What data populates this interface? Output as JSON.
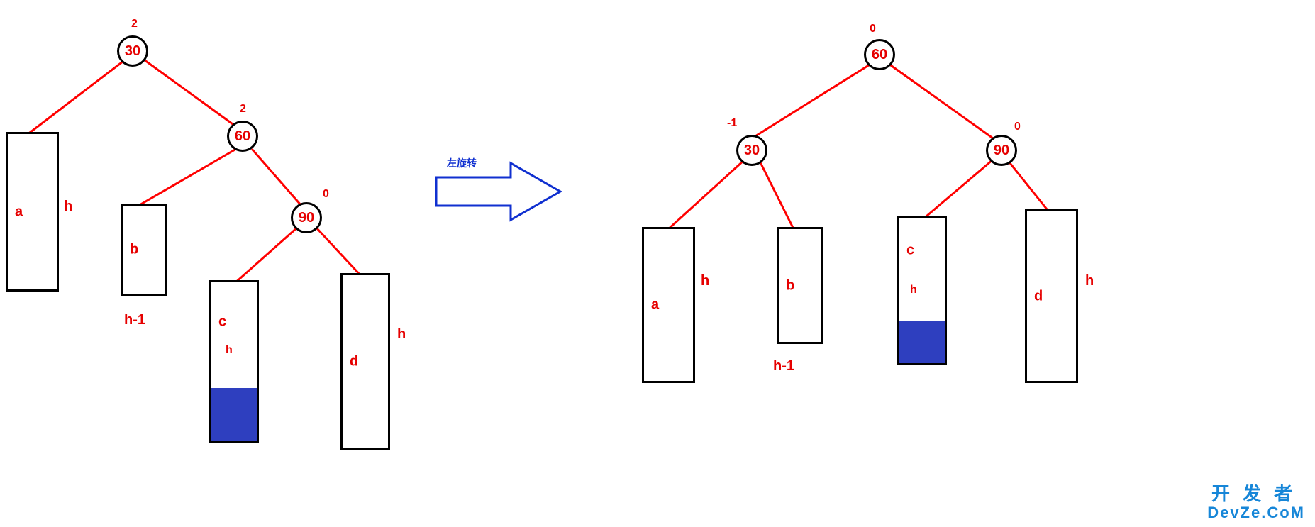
{
  "operation_label": "左旋转",
  "watermark": {
    "line1": "开发者",
    "line2": "DevZe.CoM"
  },
  "left_tree": {
    "nodes": {
      "n30": {
        "value": "30",
        "balance": "2"
      },
      "n60": {
        "value": "60",
        "balance": "2"
      },
      "n90": {
        "value": "90",
        "balance": "0"
      }
    },
    "subtrees": {
      "a": {
        "label": "a",
        "height_label": "h"
      },
      "b": {
        "label": "b",
        "height_label": "h-1"
      },
      "c": {
        "label": "c",
        "height_label": "h",
        "has_fill": true
      },
      "d": {
        "label": "d",
        "height_label": "h"
      }
    }
  },
  "right_tree": {
    "nodes": {
      "n60": {
        "value": "60",
        "balance": "0"
      },
      "n30": {
        "value": "30",
        "balance": "-1"
      },
      "n90": {
        "value": "90",
        "balance": "0"
      }
    },
    "subtrees": {
      "a": {
        "label": "a",
        "height_label": "h"
      },
      "b": {
        "label": "b",
        "height_label": "h-1"
      },
      "c": {
        "label": "c",
        "height_label": "h",
        "has_fill": true
      },
      "d": {
        "label": "d",
        "height_label": "h"
      }
    }
  },
  "chart_data": {
    "type": "table",
    "description": "AVL left-rotation before/after",
    "before": {
      "root": 30,
      "edges": [
        [
          30,
          "a"
        ],
        [
          30,
          60
        ],
        [
          60,
          "b"
        ],
        [
          60,
          90
        ],
        [
          90,
          "c"
        ],
        [
          90,
          "d"
        ]
      ],
      "balance": {
        "30": 2,
        "60": 2,
        "90": 0
      },
      "subtree_heights": {
        "a": "h",
        "b": "h-1",
        "c": "h",
        "d": "h"
      }
    },
    "after": {
      "root": 60,
      "edges": [
        [
          60,
          30
        ],
        [
          60,
          90
        ],
        [
          30,
          "a"
        ],
        [
          30,
          "b"
        ],
        [
          90,
          "c"
        ],
        [
          90,
          "d"
        ]
      ],
      "balance": {
        "60": 0,
        "30": -1,
        "90": 0
      },
      "subtree_heights": {
        "a": "h",
        "b": "h-1",
        "c": "h",
        "d": "h"
      }
    }
  }
}
